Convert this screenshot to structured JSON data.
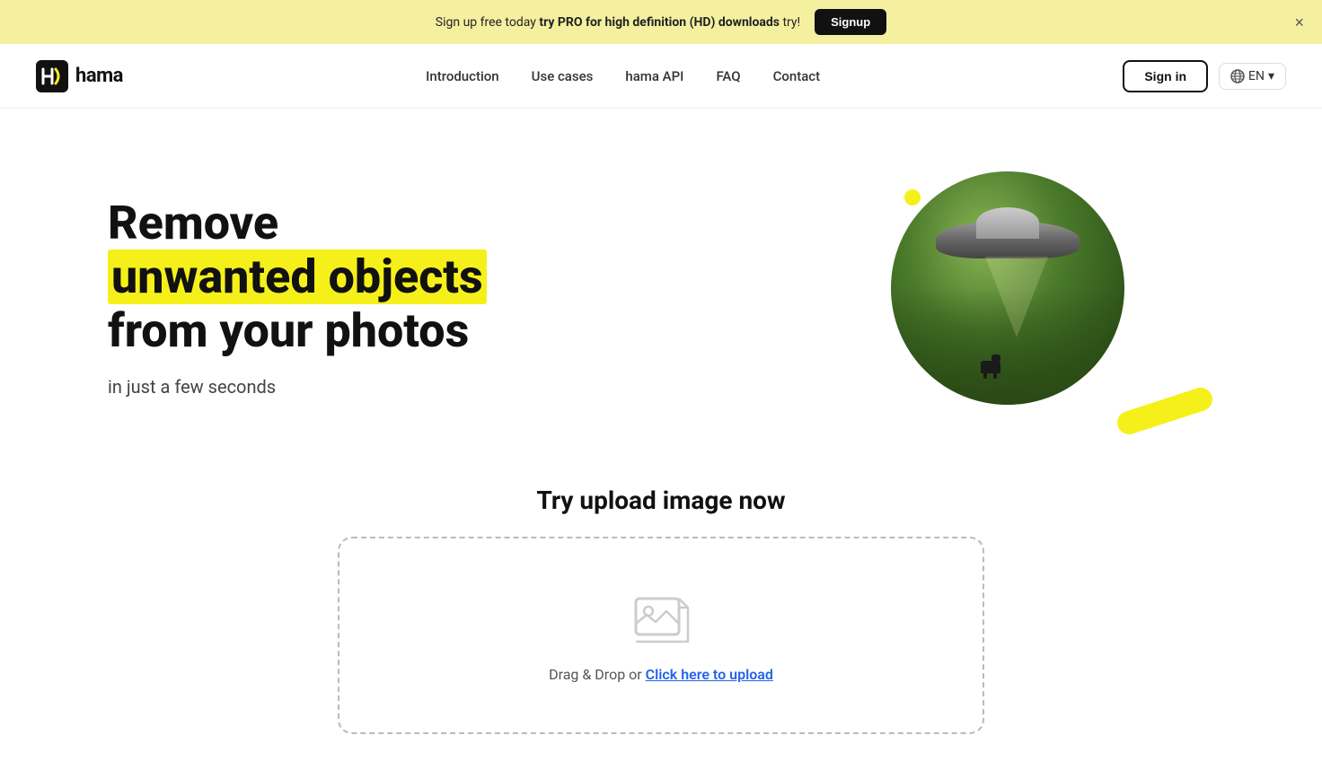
{
  "banner": {
    "text_before": "Sign up free today ",
    "cta_text": "try PRO for high definition (HD) downloads",
    "text_after": " try!",
    "signup_label": "Signup",
    "close_label": "×"
  },
  "navbar": {
    "logo_text": "hama",
    "nav_links": [
      {
        "id": "introduction",
        "label": "Introduction"
      },
      {
        "id": "use-cases",
        "label": "Use cases"
      },
      {
        "id": "hama-api",
        "label": "hama API"
      },
      {
        "id": "faq",
        "label": "FAQ"
      },
      {
        "id": "contact",
        "label": "Contact"
      }
    ],
    "sign_in_label": "Sign in",
    "lang_code": "EN",
    "lang_chevron": "▾"
  },
  "hero": {
    "title_line1": "Remove",
    "title_highlight": "unwanted objects",
    "title_line3": "from your photos",
    "subtitle": "in just a few seconds"
  },
  "try_upload": {
    "title": "Try upload image now",
    "drag_text": "Drag & Drop or ",
    "click_text": "Click here to upload"
  },
  "colors": {
    "banner_bg": "#f5f0a0",
    "highlight_yellow": "#f5f01a",
    "accent_blue": "#2563eb"
  }
}
